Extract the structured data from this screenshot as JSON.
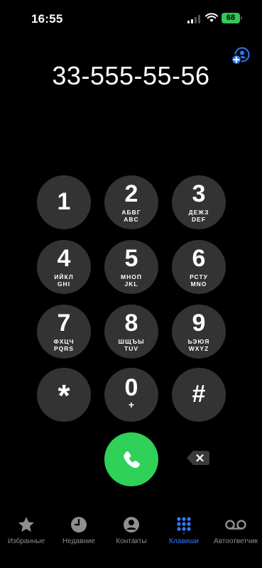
{
  "status_bar": {
    "time": "16:55",
    "battery": "68"
  },
  "dial_number": "33-555-55-56",
  "keypad": [
    {
      "digit": "1",
      "sub1": "",
      "sub2": ""
    },
    {
      "digit": "2",
      "sub1": "АБВГ",
      "sub2": "ABC"
    },
    {
      "digit": "3",
      "sub1": "ДЕЖЗ",
      "sub2": "DEF"
    },
    {
      "digit": "4",
      "sub1": "ИЙКЛ",
      "sub2": "GHI"
    },
    {
      "digit": "5",
      "sub1": "МНОП",
      "sub2": "JKL"
    },
    {
      "digit": "6",
      "sub1": "РСТУ",
      "sub2": "MNO"
    },
    {
      "digit": "7",
      "sub1": "ФХЦЧ",
      "sub2": "PQRS"
    },
    {
      "digit": "8",
      "sub1": "ШЩЪЫ",
      "sub2": "TUV"
    },
    {
      "digit": "9",
      "sub1": "ЬЭЮЯ",
      "sub2": "WXYZ"
    },
    {
      "digit": "*",
      "sub1": "",
      "sub2": ""
    },
    {
      "digit": "0",
      "sub1": "+",
      "sub2": ""
    },
    {
      "digit": "#",
      "sub1": "",
      "sub2": ""
    }
  ],
  "tabs": [
    {
      "label": "Избранные",
      "icon": "star-icon"
    },
    {
      "label": "Недавние",
      "icon": "clock-icon"
    },
    {
      "label": "Контакты",
      "icon": "person-icon"
    },
    {
      "label": "Клавиши",
      "icon": "keypad-icon",
      "active": true
    },
    {
      "label": "Автоответчик",
      "icon": "voicemail-icon"
    }
  ],
  "colors": {
    "accent": "#2f7bf6",
    "call_green": "#30d158",
    "key_bg": "#333333",
    "battery_green": "#34c759"
  }
}
